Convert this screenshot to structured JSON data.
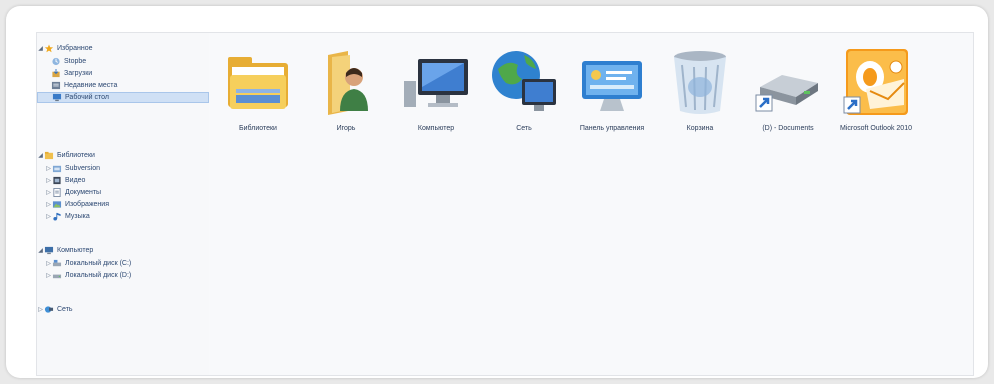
{
  "nav": {
    "favorites": {
      "label": "Избранное",
      "items": [
        {
          "label": "Stopbe",
          "icon": "recent-places-icon"
        },
        {
          "label": "Загрузки",
          "icon": "downloads-icon"
        },
        {
          "label": "Недавние места",
          "icon": "recent-icon"
        },
        {
          "label": "Рабочий стол",
          "icon": "desktop-icon",
          "selected": true
        }
      ]
    },
    "libraries": {
      "label": "Библиотеки",
      "items": [
        {
          "label": "Subversion",
          "icon": "subversion-icon"
        },
        {
          "label": "Видео",
          "icon": "video-icon"
        },
        {
          "label": "Документы",
          "icon": "documents-icon"
        },
        {
          "label": "Изображения",
          "icon": "pictures-icon"
        },
        {
          "label": "Музыка",
          "icon": "music-icon"
        }
      ]
    },
    "computer": {
      "label": "Компьютер",
      "items": [
        {
          "label": "Локальный диск (C:)",
          "icon": "local-disk-icon"
        },
        {
          "label": "Локальный диск (D:)",
          "icon": "local-disk-icon"
        }
      ]
    },
    "network": {
      "label": "Сеть",
      "icon": "network-icon"
    }
  },
  "content": {
    "items": [
      {
        "label": "Библиотеки",
        "icon": "libraries-icon"
      },
      {
        "label": "Игорь",
        "icon": "user-folder-icon"
      },
      {
        "label": "Компьютер",
        "icon": "computer-icon"
      },
      {
        "label": "Сеть",
        "icon": "network-globe-icon"
      },
      {
        "label": "Панель управления",
        "icon": "control-panel-icon"
      },
      {
        "label": "Корзина",
        "icon": "recycle-bin-icon"
      },
      {
        "label": "(D) - Documents",
        "icon": "drive-shortcut-icon"
      },
      {
        "label": "Microsoft Outlook 2010",
        "icon": "outlook-icon"
      }
    ]
  },
  "colors": {
    "selection": "#cfe0f5",
    "nav_text": "#2c4872",
    "folder_yellow": "#f3c14a",
    "outlook_orange": "#f59a1b"
  }
}
